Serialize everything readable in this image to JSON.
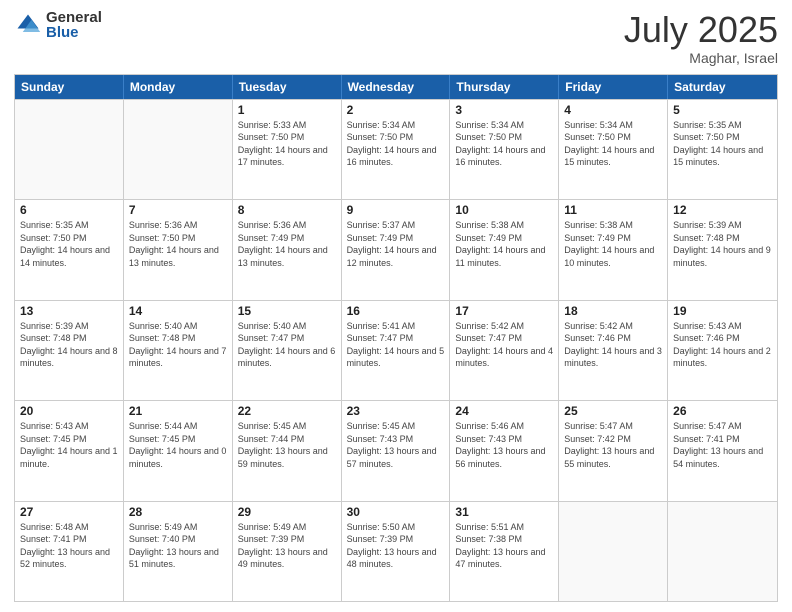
{
  "header": {
    "logo_general": "General",
    "logo_blue": "Blue",
    "month": "July 2025",
    "location": "Maghar, Israel"
  },
  "days_of_week": [
    "Sunday",
    "Monday",
    "Tuesday",
    "Wednesday",
    "Thursday",
    "Friday",
    "Saturday"
  ],
  "weeks": [
    [
      {
        "day": null
      },
      {
        "day": null
      },
      {
        "day": "1",
        "sunrise": "Sunrise: 5:33 AM",
        "sunset": "Sunset: 7:50 PM",
        "daylight": "Daylight: 14 hours and 17 minutes."
      },
      {
        "day": "2",
        "sunrise": "Sunrise: 5:34 AM",
        "sunset": "Sunset: 7:50 PM",
        "daylight": "Daylight: 14 hours and 16 minutes."
      },
      {
        "day": "3",
        "sunrise": "Sunrise: 5:34 AM",
        "sunset": "Sunset: 7:50 PM",
        "daylight": "Daylight: 14 hours and 16 minutes."
      },
      {
        "day": "4",
        "sunrise": "Sunrise: 5:34 AM",
        "sunset": "Sunset: 7:50 PM",
        "daylight": "Daylight: 14 hours and 15 minutes."
      },
      {
        "day": "5",
        "sunrise": "Sunrise: 5:35 AM",
        "sunset": "Sunset: 7:50 PM",
        "daylight": "Daylight: 14 hours and 15 minutes."
      }
    ],
    [
      {
        "day": "6",
        "sunrise": "Sunrise: 5:35 AM",
        "sunset": "Sunset: 7:50 PM",
        "daylight": "Daylight: 14 hours and 14 minutes."
      },
      {
        "day": "7",
        "sunrise": "Sunrise: 5:36 AM",
        "sunset": "Sunset: 7:50 PM",
        "daylight": "Daylight: 14 hours and 13 minutes."
      },
      {
        "day": "8",
        "sunrise": "Sunrise: 5:36 AM",
        "sunset": "Sunset: 7:49 PM",
        "daylight": "Daylight: 14 hours and 13 minutes."
      },
      {
        "day": "9",
        "sunrise": "Sunrise: 5:37 AM",
        "sunset": "Sunset: 7:49 PM",
        "daylight": "Daylight: 14 hours and 12 minutes."
      },
      {
        "day": "10",
        "sunrise": "Sunrise: 5:38 AM",
        "sunset": "Sunset: 7:49 PM",
        "daylight": "Daylight: 14 hours and 11 minutes."
      },
      {
        "day": "11",
        "sunrise": "Sunrise: 5:38 AM",
        "sunset": "Sunset: 7:49 PM",
        "daylight": "Daylight: 14 hours and 10 minutes."
      },
      {
        "day": "12",
        "sunrise": "Sunrise: 5:39 AM",
        "sunset": "Sunset: 7:48 PM",
        "daylight": "Daylight: 14 hours and 9 minutes."
      }
    ],
    [
      {
        "day": "13",
        "sunrise": "Sunrise: 5:39 AM",
        "sunset": "Sunset: 7:48 PM",
        "daylight": "Daylight: 14 hours and 8 minutes."
      },
      {
        "day": "14",
        "sunrise": "Sunrise: 5:40 AM",
        "sunset": "Sunset: 7:48 PM",
        "daylight": "Daylight: 14 hours and 7 minutes."
      },
      {
        "day": "15",
        "sunrise": "Sunrise: 5:40 AM",
        "sunset": "Sunset: 7:47 PM",
        "daylight": "Daylight: 14 hours and 6 minutes."
      },
      {
        "day": "16",
        "sunrise": "Sunrise: 5:41 AM",
        "sunset": "Sunset: 7:47 PM",
        "daylight": "Daylight: 14 hours and 5 minutes."
      },
      {
        "day": "17",
        "sunrise": "Sunrise: 5:42 AM",
        "sunset": "Sunset: 7:47 PM",
        "daylight": "Daylight: 14 hours and 4 minutes."
      },
      {
        "day": "18",
        "sunrise": "Sunrise: 5:42 AM",
        "sunset": "Sunset: 7:46 PM",
        "daylight": "Daylight: 14 hours and 3 minutes."
      },
      {
        "day": "19",
        "sunrise": "Sunrise: 5:43 AM",
        "sunset": "Sunset: 7:46 PM",
        "daylight": "Daylight: 14 hours and 2 minutes."
      }
    ],
    [
      {
        "day": "20",
        "sunrise": "Sunrise: 5:43 AM",
        "sunset": "Sunset: 7:45 PM",
        "daylight": "Daylight: 14 hours and 1 minute."
      },
      {
        "day": "21",
        "sunrise": "Sunrise: 5:44 AM",
        "sunset": "Sunset: 7:45 PM",
        "daylight": "Daylight: 14 hours and 0 minutes."
      },
      {
        "day": "22",
        "sunrise": "Sunrise: 5:45 AM",
        "sunset": "Sunset: 7:44 PM",
        "daylight": "Daylight: 13 hours and 59 minutes."
      },
      {
        "day": "23",
        "sunrise": "Sunrise: 5:45 AM",
        "sunset": "Sunset: 7:43 PM",
        "daylight": "Daylight: 13 hours and 57 minutes."
      },
      {
        "day": "24",
        "sunrise": "Sunrise: 5:46 AM",
        "sunset": "Sunset: 7:43 PM",
        "daylight": "Daylight: 13 hours and 56 minutes."
      },
      {
        "day": "25",
        "sunrise": "Sunrise: 5:47 AM",
        "sunset": "Sunset: 7:42 PM",
        "daylight": "Daylight: 13 hours and 55 minutes."
      },
      {
        "day": "26",
        "sunrise": "Sunrise: 5:47 AM",
        "sunset": "Sunset: 7:41 PM",
        "daylight": "Daylight: 13 hours and 54 minutes."
      }
    ],
    [
      {
        "day": "27",
        "sunrise": "Sunrise: 5:48 AM",
        "sunset": "Sunset: 7:41 PM",
        "daylight": "Daylight: 13 hours and 52 minutes."
      },
      {
        "day": "28",
        "sunrise": "Sunrise: 5:49 AM",
        "sunset": "Sunset: 7:40 PM",
        "daylight": "Daylight: 13 hours and 51 minutes."
      },
      {
        "day": "29",
        "sunrise": "Sunrise: 5:49 AM",
        "sunset": "Sunset: 7:39 PM",
        "daylight": "Daylight: 13 hours and 49 minutes."
      },
      {
        "day": "30",
        "sunrise": "Sunrise: 5:50 AM",
        "sunset": "Sunset: 7:39 PM",
        "daylight": "Daylight: 13 hours and 48 minutes."
      },
      {
        "day": "31",
        "sunrise": "Sunrise: 5:51 AM",
        "sunset": "Sunset: 7:38 PM",
        "daylight": "Daylight: 13 hours and 47 minutes."
      },
      {
        "day": null
      },
      {
        "day": null
      }
    ]
  ]
}
